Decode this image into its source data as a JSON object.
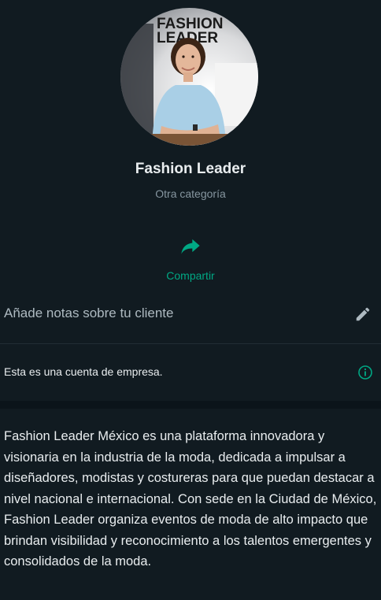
{
  "profile": {
    "avatar_logo_text": "FASHION LEADER",
    "name": "Fashion Leader",
    "category": "Otra categoría"
  },
  "actions": {
    "share_icon": "share-arrow-icon",
    "share_label": "Compartir"
  },
  "notes": {
    "placeholder": "Añade notas sobre tu cliente",
    "edit_icon": "pencil-icon"
  },
  "business": {
    "text": "Esta es una cuenta de empresa.",
    "info_icon": "info-icon"
  },
  "about": {
    "text": "Fashion Leader México es una plataforma innovadora y visionaria en la industria de la moda, dedicada a impulsar a diseñadores, modistas y costureras para que puedan destacar a nivel nacional e internacional. Con sede en la Ciudad de México, Fashion Leader organiza eventos de moda de alto impacto que brindan visibilidad y reconocimiento a los talentos emergentes y consolidados de la moda."
  },
  "colors": {
    "background": "#111b21",
    "accent": "#00a884",
    "secondary_text": "#8696a0",
    "primary_text": "#e9edef"
  }
}
